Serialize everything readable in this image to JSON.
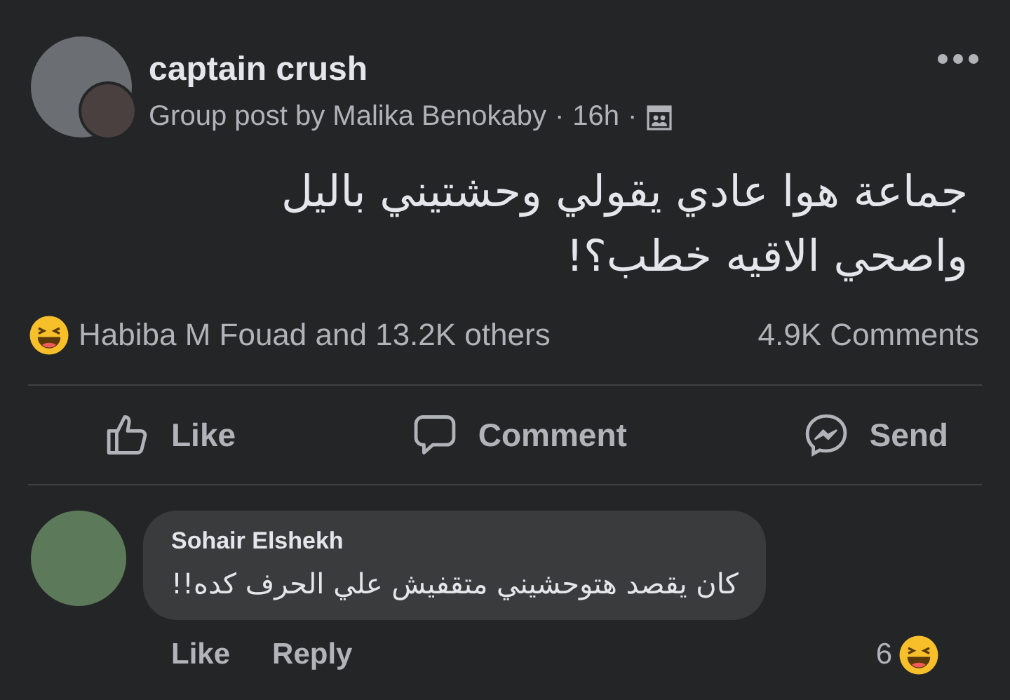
{
  "post": {
    "author": "captain crush",
    "subtitle": "Group post by Malika Benokaby",
    "time": "16h",
    "separator": "·",
    "text": "جماعة هوا عادي يقولي وحشتيني باليل\nواصحي الاقيه خطب؟!"
  },
  "reactions": {
    "summary": "Habiba M Fouad and 13.2K others",
    "comments": "4.9K Comments"
  },
  "actions": [
    {
      "kind": "like",
      "label": "Like"
    },
    {
      "kind": "comment",
      "label": "Comment"
    },
    {
      "kind": "send",
      "label": "Send"
    }
  ],
  "comments": [
    {
      "author": "Sohair Elshekh",
      "text": "كان يقصد هتوحشيني متقفيش علي الحرف كده!!",
      "like": "Like",
      "reply": "Reply",
      "reaction_count": "6"
    }
  ]
}
